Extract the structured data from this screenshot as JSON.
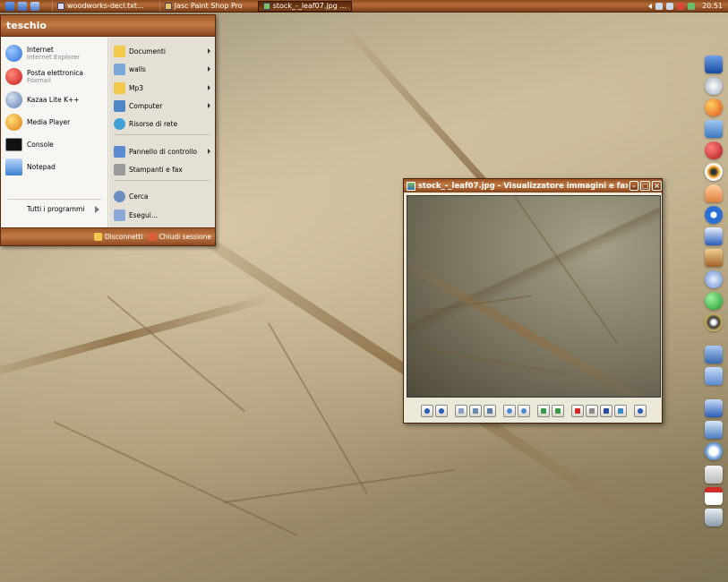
{
  "taskbar": {
    "tasks": [
      {
        "label": "woodworks-decl.txt...",
        "active": false
      },
      {
        "label": "Jasc Paint Shop Pro",
        "active": false
      },
      {
        "label": "stock_-_leaf07.jpg ...",
        "active": true
      }
    ],
    "clock": "20.51"
  },
  "start_menu": {
    "user": "teschio",
    "pinned": [
      {
        "title": "Internet",
        "subtitle": "Internet Explorer",
        "icon": "internet-explorer-icon",
        "color": "#2a6fd6"
      },
      {
        "title": "Posta elettronica",
        "subtitle": "Foxmail",
        "icon": "foxmail-icon",
        "color": "#d42a2a"
      },
      {
        "title": "Kazaa Lite K++",
        "subtitle": "",
        "icon": "kazaa-icon",
        "color": "#5c7fb0"
      },
      {
        "title": "Media Player",
        "subtitle": "",
        "icon": "media-player-icon",
        "color": "#f0a020"
      },
      {
        "title": "Console",
        "subtitle": "",
        "icon": "console-icon",
        "color": "#111111"
      },
      {
        "title": "Notepad",
        "subtitle": "",
        "icon": "notepad-icon",
        "color": "#3a7fd0"
      }
    ],
    "all_programs": "Tutti i programmi",
    "places": [
      {
        "label": "Documenti",
        "has_submenu": true,
        "icon": "documents-folder-icon",
        "color": "#f2c94c"
      },
      {
        "label": "walls",
        "has_submenu": true,
        "icon": "pictures-folder-icon",
        "color": "#7aa6d8"
      },
      {
        "label": "Mp3",
        "has_submenu": true,
        "icon": "music-folder-icon",
        "color": "#f2c94c"
      },
      {
        "label": "Computer",
        "has_submenu": true,
        "icon": "computer-icon",
        "color": "#4f86c6"
      },
      {
        "label": "Risorse di rete",
        "has_submenu": false,
        "icon": "network-icon",
        "color": "#3fa0d8"
      },
      {
        "label": "Pannello di controllo",
        "has_submenu": true,
        "icon": "control-panel-icon",
        "color": "#5a8ad0"
      },
      {
        "label": "Stampanti e fax",
        "has_submenu": false,
        "icon": "printer-icon",
        "color": "#9a9a9a"
      },
      {
        "label": "Cerca",
        "has_submenu": false,
        "icon": "search-icon",
        "color": "#6a8fc0"
      },
      {
        "label": "Esegui...",
        "has_submenu": false,
        "icon": "run-icon",
        "color": "#8aa8d8"
      }
    ],
    "logoff": "Disconnetti",
    "shutdown": "Chiudi sessione"
  },
  "viewer": {
    "title": "stock_-_leaf07.jpg - Visualizzatore immagini e fax ..."
  },
  "colors": {
    "wood_dark": "#7a3e18",
    "wood_light": "#c27a44"
  }
}
